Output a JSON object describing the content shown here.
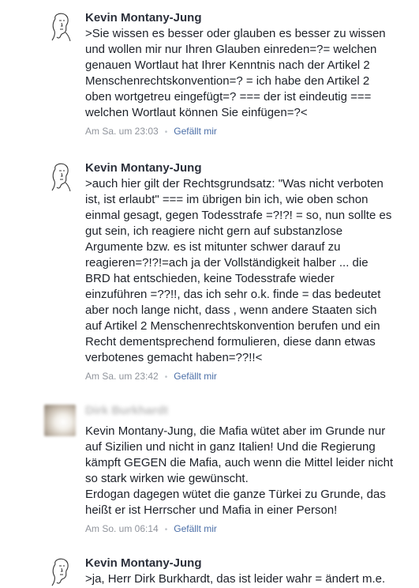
{
  "comments": [
    {
      "author": "Kevin Montany-Jung",
      "text": ">Sie wissen es besser oder glauben es besser zu wissen\nund wollen mir nur Ihren Glauben einreden=?= welchen\ngenauen Wortlaut hat Ihrer Kenntnis nach der Artikel 2\nMenschenrechtskonvention=? = ich habe den Artikel 2\noben wortgetreu eingefügt=? === der ist eindeutig ===\nwelchen Wortlaut können Sie einfügen=?<",
      "time": "Am Sa. um 23:03",
      "like_label": "Gefällt mir"
    },
    {
      "author": "Kevin Montany-Jung",
      "text": ">auch hier gilt der Rechtsgrundsatz: \"Was nicht verboten\nist, ist erlaubt\" === im übrigen bin ich, wie oben schon\neinmal gesagt, gegen Todesstrafe =?!?! = so, nun sollte es\ngut sein, ich reagiere nicht gern auf substanzlose\nArgumente bzw. es ist mitunter schwer darauf zu\nreagieren=?!?!=ach ja der Vollständigkeit halber ... die\nBRD hat entschieden, keine Todesstrafe wieder\neinzuführen =??!!, das ich sehr o.k. finde = das bedeutet\naber noch lange  nicht, dass , wenn andere Staaten sich\nauf Artikel 2 Menschenrechtskonvention berufen und ein\nRecht  dementsprechend  formulieren, diese dann etwas\nverbotenes gemacht haben=??!!<",
      "time": "Am Sa. um 23:42",
      "like_label": "Gefällt mir"
    },
    {
      "author": "Dirk Burkhardt",
      "text": "Kevin Montany-Jung, die Mafia wütet aber im Grunde nur\nauf Sizilien und nicht in ganz Italien! Und die Regierung\nkämpft GEGEN die Mafia, auch wenn die Mittel leider nicht\nso stark wirken wie gewünscht.\nErdogan dagegen wütet die ganze Türkei zu Grunde, das\nheißt er ist Herrscher und Mafia in einer Person!",
      "time": "Am So. um 06:14",
      "like_label": "Gefällt mir"
    },
    {
      "author": "Kevin Montany-Jung",
      "text": ">ja, Herr Dirk Burkhardt, das ist leider wahr = ändert m.e.",
      "time": "",
      "like_label": ""
    }
  ],
  "separator": "•"
}
